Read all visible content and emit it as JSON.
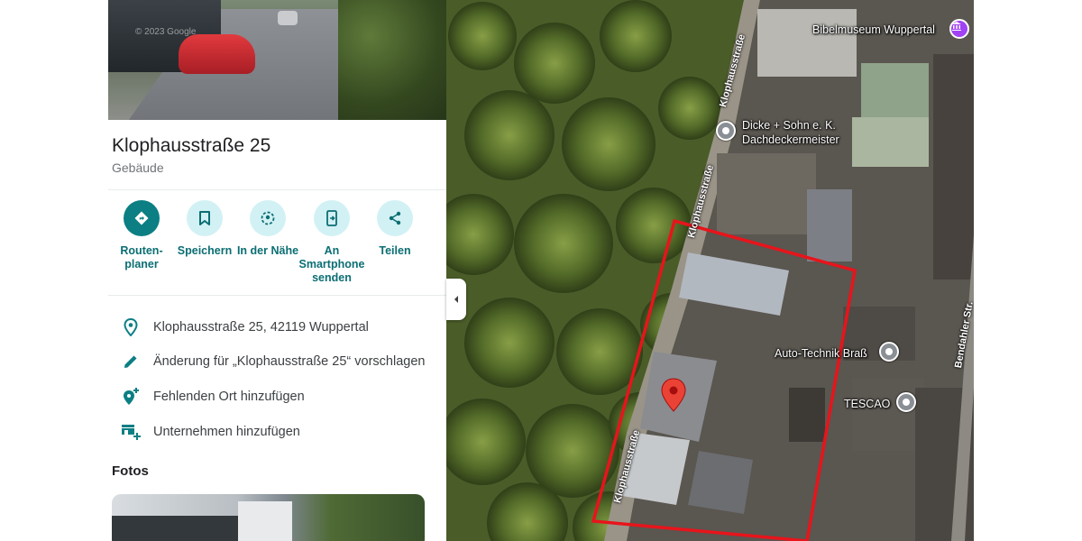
{
  "place": {
    "title": "Klophausstraße 25",
    "category": "Gebäude"
  },
  "actions": [
    {
      "label": "Routen-\nplaner",
      "icon": "directions-icon"
    },
    {
      "label": "Speichern",
      "icon": "bookmark-icon"
    },
    {
      "label": "In der Nähe",
      "icon": "nearby-icon"
    },
    {
      "label": "An\nSmartphone\nsenden",
      "icon": "send-to-phone-icon"
    },
    {
      "label": "Teilen",
      "icon": "share-icon"
    }
  ],
  "details": {
    "address": "Klophausstraße 25, 42119 Wuppertal",
    "suggest_edit": "Änderung für „Klophausstraße 25“ vorschlagen",
    "add_missing_place": "Fehlenden Ort hinzufügen",
    "add_business": "Unternehmen hinzufügen"
  },
  "photos": {
    "heading": "Fotos"
  },
  "hero_watermark": "© 2023 Google",
  "map": {
    "pois": {
      "bibelmuseum": "Bibelmuseum Wuppertal",
      "dicke_line1": "Dicke + Sohn e. K.",
      "dicke_line2": "Dachdeckermeister",
      "auto_technik": "Auto-Technik Braß",
      "tescao": "TESCAO"
    },
    "streets": {
      "klophaus_top": "Klophausstraße",
      "klophaus_mid": "Klophausstraße",
      "klophaus_bottom": "Klophausstraße",
      "bendahler": "Bendahler Str."
    }
  },
  "colors": {
    "accent": "#0b7f83",
    "accent_light": "#d2f1f4",
    "highlight_outline": "#e8141b",
    "marker": "#ea4335"
  }
}
